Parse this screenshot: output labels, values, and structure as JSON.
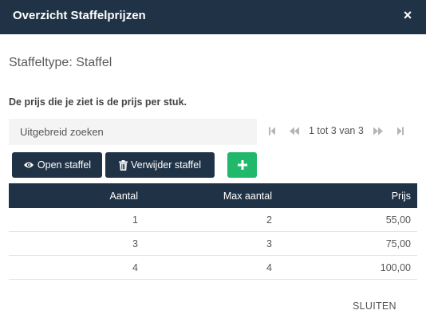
{
  "dialog": {
    "title": "Overzicht Staffelprijzen",
    "close_symbol": "×",
    "type_label": "Staffeltype: Staffel",
    "note": "De prijs die je ziet is de prijs per stuk.",
    "close_button": "SLUITEN"
  },
  "search": {
    "placeholder": "Uitgebreid zoeken",
    "value": ""
  },
  "pager": {
    "text": "1 tot 3 van 3"
  },
  "toolbar": {
    "open_label": "Open staffel",
    "delete_label": "Verwijder staffel",
    "add_icon": "plus-icon"
  },
  "table": {
    "headers": [
      "Aantal",
      "Max aantal",
      "Prijs"
    ],
    "rows": [
      [
        "1",
        "2",
        "55,00"
      ],
      [
        "3",
        "3",
        "75,00"
      ],
      [
        "4",
        "4",
        "100,00"
      ]
    ]
  },
  "colors": {
    "header_bg": "#203346",
    "add_button": "#20b86a",
    "pager_icons": "#b5b5b5"
  }
}
